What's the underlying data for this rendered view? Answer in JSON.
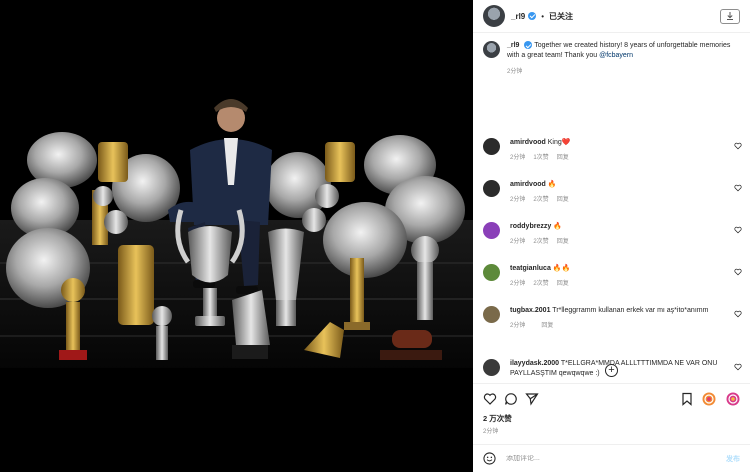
{
  "post": {
    "username": "_rl9",
    "follow_status": "已关注",
    "caption": {
      "username": "_rl9",
      "text": "Together we created history! 8 years of unforgettable memories with a great team! Thank you ",
      "mention": "@fcbayern",
      "time": "2分钟"
    },
    "likes": "2 万次赞",
    "time": "2分钟",
    "comment_placeholder": "添加评论...",
    "publish_label": "发布"
  },
  "comments": [
    {
      "username": "amirdvood",
      "text": "King",
      "emoji": "❤️",
      "time": "2分钟",
      "likes": "1次赞",
      "reply": "回复",
      "avatar_color": "#2b2b2b"
    },
    {
      "username": "amirdvood",
      "text": "",
      "emoji": "🔥",
      "time": "2分钟",
      "likes": "2次赞",
      "reply": "回复",
      "avatar_color": "#2b2b2b"
    },
    {
      "username": "roddybrezzy",
      "text": "",
      "emoji": "🔥",
      "time": "2分钟",
      "likes": "2次赞",
      "reply": "回复",
      "avatar_color": "#8a3fb8"
    },
    {
      "username": "teatgianluca",
      "text": "",
      "emoji": "🔥🔥",
      "time": "2分钟",
      "likes": "2次赞",
      "reply": "回复",
      "avatar_color": "#5d8a3a"
    },
    {
      "username": "tugbax.2001",
      "text": "Tr*lleggrramm kullanan erkek var mı aş*ito*anımm",
      "emoji": "",
      "time": "2分钟",
      "likes": "",
      "reply": "回复",
      "avatar_color": "#7a6a4a"
    },
    {
      "username": "ilayydask.2000",
      "text": "T*ELLGRA*MMDA ALLLTTTIMMDA NE VAR ONU PAYLLASŞTIM qewqwqwe :)",
      "emoji": "",
      "time": "2分钟",
      "likes": "3次赞",
      "reply": "回复",
      "avatar_color": "#3a3a3a"
    }
  ],
  "icons": {
    "download": "download-icon",
    "like": "heart-icon",
    "comment": "comment-icon",
    "share": "send-icon",
    "save": "bookmark-icon",
    "emoji": "smiley-icon",
    "more": "plus-circle-icon"
  },
  "colors": {
    "link": "#00376b",
    "verified": "#3897f0",
    "muted": "#8e8e8e"
  }
}
